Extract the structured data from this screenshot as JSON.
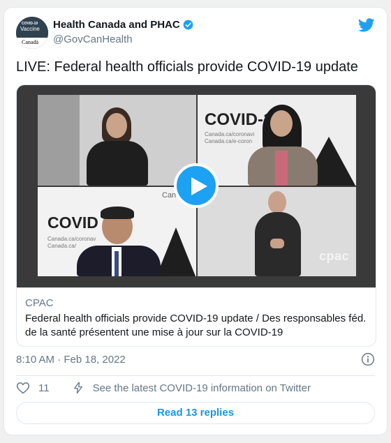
{
  "tweet": {
    "author_name": "Health Canada and PHAC",
    "author_handle": "@GovCanHealth",
    "avatar_text_top": "COVID-19",
    "avatar_text_mid": "Vaccine",
    "avatar_text_bottom": "Canadä",
    "text": "LIVE: Federal health officials provide COVID-19 update",
    "timestamp": "8:10 AM · Feb 18, 2022",
    "icons": {
      "verified": "verified-badge-icon",
      "brand": "twitter-bird-icon",
      "info": "info-icon",
      "like": "heart-icon",
      "bolt": "lightning-bolt-icon",
      "play": "play-icon"
    },
    "colors": {
      "accent": "#1da1f2",
      "link": "#1b95e0",
      "muted": "#657786",
      "text": "#14171a"
    }
  },
  "media": {
    "video_text_covid": "COVID-1",
    "video_text_covid2": "COVID",
    "video_text_url1": "Canada.ca/coronavi",
    "video_text_url2": "Canada.ca/e-coron",
    "video_text_url3": "Canada.ca/coronav",
    "video_text_url4": "Canada.ca/",
    "video_text_can": "Can",
    "watermark": "cpac",
    "source": "CPAC",
    "title": "Federal health officials provide COVID-19 update / Des responsables féd. de la santé présentent une mise à jour sur la COVID-19"
  },
  "actions": {
    "like_count": "11",
    "latest_label": "See the latest COVID-19 information on Twitter",
    "replies_label": "Read 13 replies"
  }
}
